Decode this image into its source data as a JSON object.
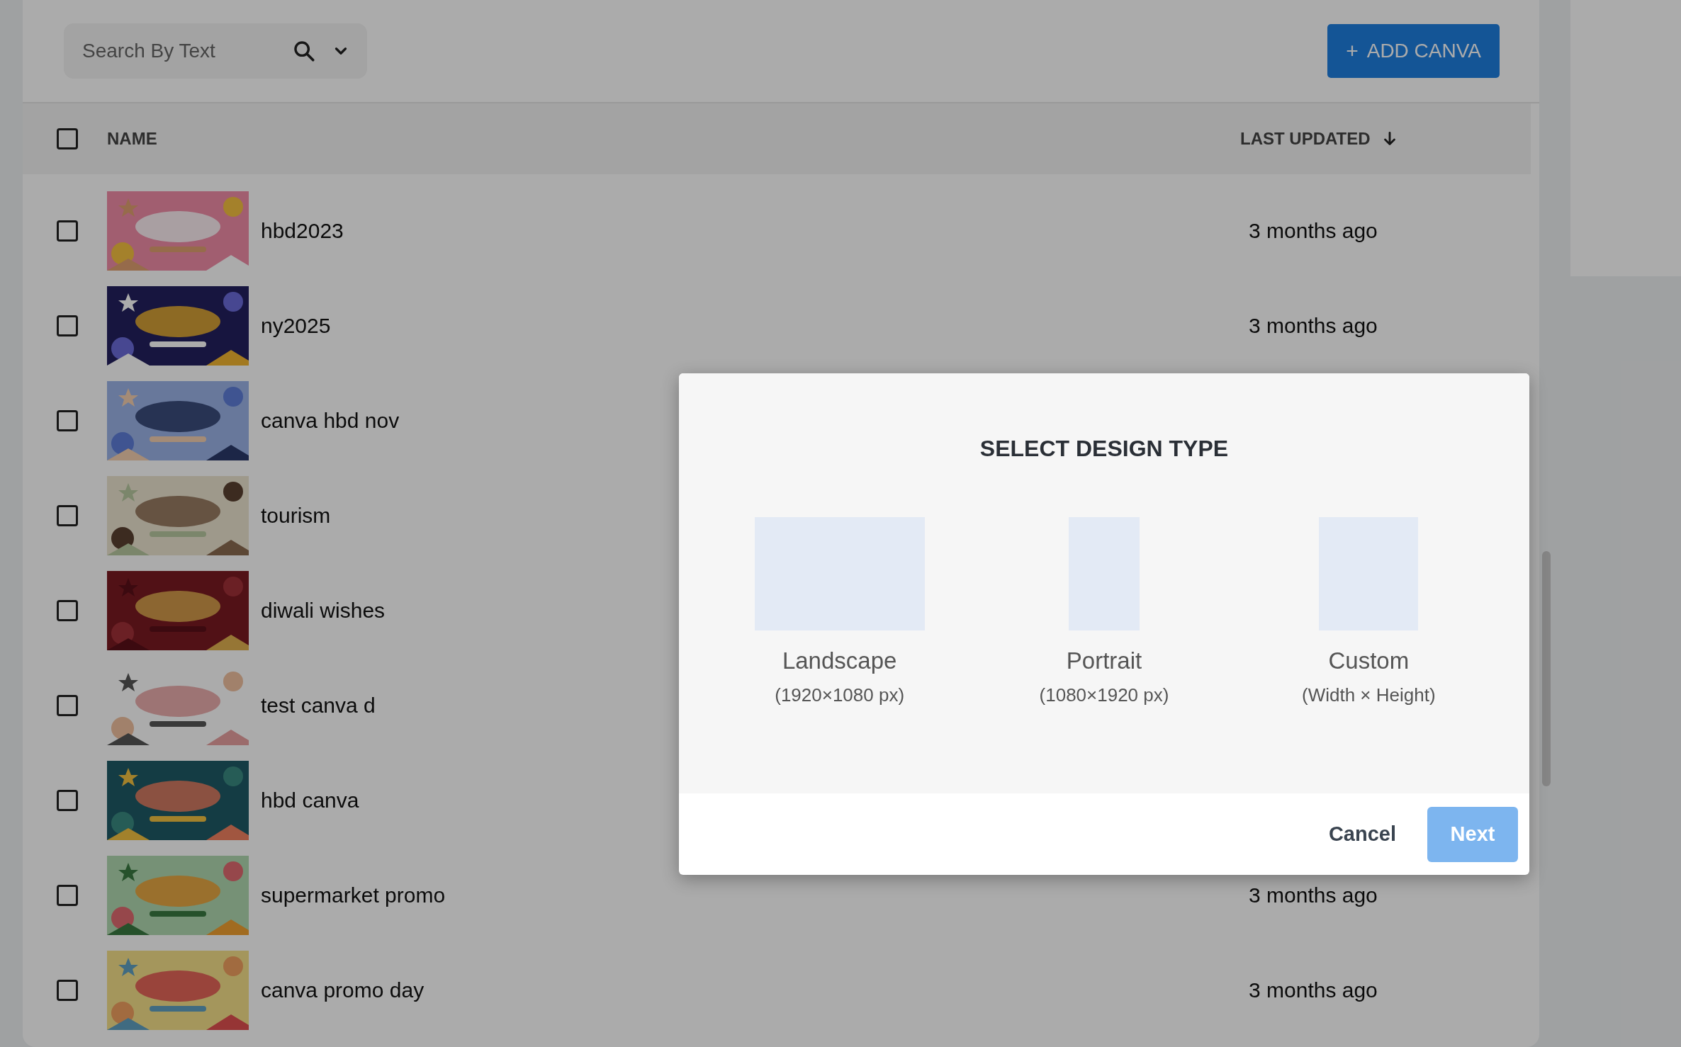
{
  "toolbar": {
    "search": {
      "placeholder": "Search By Text"
    },
    "add_button": {
      "icon": "+",
      "label": "ADD CANVA"
    }
  },
  "table": {
    "select_all": {
      "checked": false
    },
    "columns": [
      {
        "label": "NAME",
        "sorted": false
      },
      {
        "label": "LAST UPDATED",
        "sorted": true
      }
    ],
    "rows": [
      {
        "name": "hbd2023",
        "last_updated": "3 months ago",
        "checked": false
      },
      {
        "name": "ny2025",
        "last_updated": "3 months ago",
        "checked": false
      },
      {
        "name": "canva hbd nov",
        "checked": false
      },
      {
        "name": "tourism",
        "checked": false
      },
      {
        "name": "diwali wishes",
        "checked": false
      },
      {
        "name": "test canva d",
        "checked": false
      },
      {
        "name": "hbd canva",
        "checked": false
      },
      {
        "name": "supermarket promo",
        "last_updated": "3 months ago",
        "checked": false
      },
      {
        "name": "canva promo day",
        "last_updated": "3 months ago",
        "checked": false
      }
    ]
  },
  "dialog": {
    "title": "SELECT DESIGN TYPE",
    "options": [
      {
        "kind": "landscape",
        "label": "Landscape",
        "detail": "(1920×1080 px)",
        "selected": false
      },
      {
        "kind": "portrait",
        "label": "Portrait",
        "detail": "(1080×1920 px)",
        "selected": false
      },
      {
        "kind": "custom",
        "label": "Custom",
        "detail": "(Width × Height)",
        "selected": false
      }
    ],
    "cancel": "Cancel",
    "next": {
      "label": "Next",
      "disabled": true
    }
  }
}
